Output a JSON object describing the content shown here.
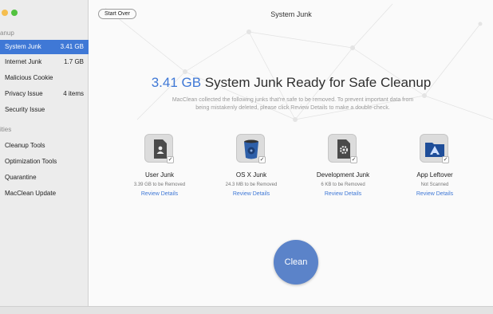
{
  "window": {
    "title": "System Junk"
  },
  "toolbar": {
    "start_over_label": "Start Over"
  },
  "sidebar": {
    "section_cleanup": "anup",
    "section_utilities": "ities",
    "items": [
      {
        "label": "System Junk",
        "value": "3.41 GB",
        "active": true
      },
      {
        "label": "Internet Junk",
        "value": "1.7 GB"
      },
      {
        "label": "Malicious Cookie",
        "value": ""
      },
      {
        "label": "Privacy Issue",
        "value": "4 items"
      },
      {
        "label": "Security Issue",
        "value": ""
      }
    ],
    "utilities": [
      {
        "label": "Cleanup Tools"
      },
      {
        "label": "Optimization Tools"
      },
      {
        "label": "Quarantine"
      },
      {
        "label": "MacClean Update"
      }
    ]
  },
  "main": {
    "headline_size": "3.41 GB",
    "headline_text": " System Junk Ready for Safe Cleanup",
    "subtext": "MacClean collected the following junks that're safe to be removed. To prevent important data from being mistakenly deleted, please click Review Details to make a double-check.",
    "cards": [
      {
        "name": "User Junk",
        "size": "3.39 GB to be Removed",
        "review": "Review Details",
        "icon": "user-document-icon"
      },
      {
        "name": "OS X Junk",
        "size": "24.3 MB to be Removed",
        "review": "Review Details",
        "icon": "trash-bin-icon"
      },
      {
        "name": "Development Junk",
        "size": "6 KB to be Removed",
        "review": "Review Details",
        "icon": "gear-document-icon"
      },
      {
        "name": "App Leftover",
        "size": "Not Scanned",
        "review": "Review Details",
        "icon": "applications-folder-icon"
      }
    ],
    "clean_label": "Clean"
  },
  "colors": {
    "accent": "#3f78d6",
    "clean_button": "#5b83c9",
    "sidebar_bg": "#ececec"
  }
}
